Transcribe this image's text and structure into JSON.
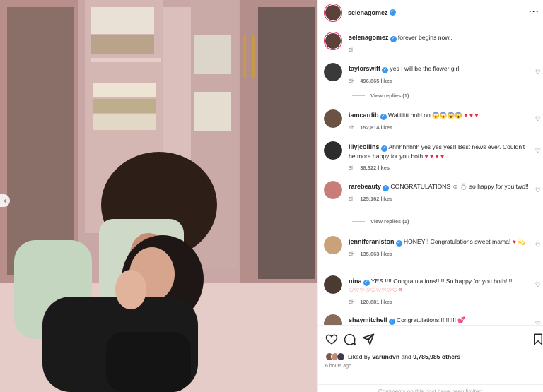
{
  "post": {
    "author": "selenagomez",
    "caption": "forever begins now..",
    "caption_time": "6h",
    "liked_by_prefix": "Liked by ",
    "liked_by_user": "varundvn",
    "liked_by_and": " and ",
    "likes_count": "9,785,985 others",
    "time_ago": "6 hours ago",
    "comments_limited": "Comments on this post have been limited."
  },
  "comments": [
    {
      "user": "taylorswift",
      "text": "yes I will be the flower girl",
      "time": "5h",
      "likes": "496,865 likes",
      "reply": "View replies (1)",
      "avatar_color": "#3a3a3a"
    },
    {
      "user": "iamcardib",
      "text": "Waiiiiittt hold on",
      "emoji": "😱😱😱😱 ♥ ♥ ♥",
      "time": "6h",
      "likes": "152,814 likes",
      "reply": "",
      "avatar_color": "#6b5344"
    },
    {
      "user": "lilyjcollins",
      "text": "Ahhhhhhhh yes yes yes!! Best news ever. Couldn't be more happy for you both",
      "emoji": "♥ ♥ ♥ ♥",
      "time": "3h",
      "likes": "38,322 likes",
      "reply": "",
      "avatar_color": "#2d2d2d"
    },
    {
      "user": "rarebeauty",
      "text": "CONGRATULATIONS",
      "text2": "so happy for you two!!",
      "emoji": "☺ 💍",
      "time": "6h",
      "likes": "125,162 likes",
      "reply": "View replies (1)",
      "avatar_color": "#c97d7a"
    },
    {
      "user": "jenniferaniston",
      "text": "HONEY!! Congratulations sweet mama!",
      "emoji": "♥ 💫",
      "time": "5h",
      "likes": "135,663 likes",
      "reply": "",
      "avatar_color": "#c9a27a"
    },
    {
      "user": "nina",
      "text": "YES !!!! Congratulations!!!!! So happy for you both!!!!",
      "emoji": "♡♡♡♡♡♡♡♡♡ ‼",
      "time": "6h",
      "likes": "120,881 likes",
      "reply": "",
      "avatar_color": "#4a3a32"
    },
    {
      "user": "shaymitchell",
      "text": "Congratulations!!!!!!!!!!",
      "emoji": "💕",
      "time": "",
      "likes": "",
      "reply": "",
      "avatar_color": "#8a6a5a"
    }
  ],
  "colors": {
    "verified": "#3897f0",
    "heart": "#ed2a3f",
    "story_ring": "#e1306c"
  },
  "icons": [
    "chevron-left-icon",
    "more-icon",
    "heart-icon",
    "comment-icon",
    "share-icon",
    "bookmark-icon",
    "verified-icon"
  ]
}
